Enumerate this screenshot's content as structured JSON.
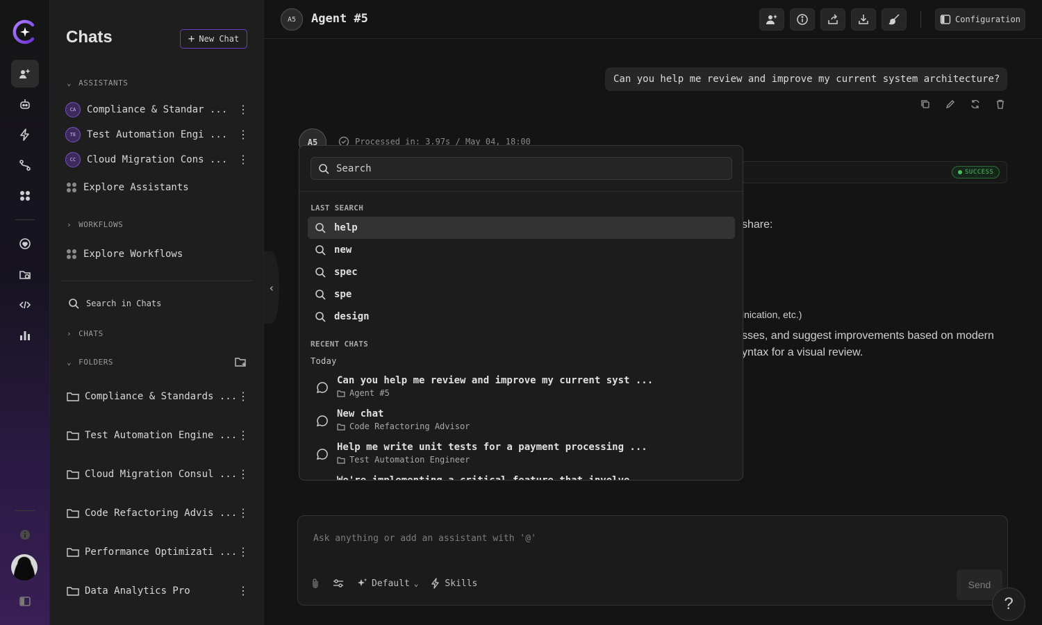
{
  "sidebar": {
    "title": "Chats",
    "new_chat": "New Chat",
    "assistants_label": "ASSISTANTS",
    "assistants": [
      {
        "initials": "CA",
        "name": "Compliance & Standar ..."
      },
      {
        "initials": "TE",
        "name": "Test Automation Engi ..."
      },
      {
        "initials": "CC",
        "name": "Cloud Migration Cons ..."
      }
    ],
    "explore_assistants": "Explore Assistants",
    "workflows_label": "WORKFLOWS",
    "explore_workflows": "Explore Workflows",
    "search_chats": "Search in Chats",
    "chats_label": "CHATS",
    "folders_label": "FOLDERS",
    "folders": [
      "Compliance & Standards ...",
      "Test Automation Engine ...",
      "Cloud Migration Consul ...",
      "Code Refactoring Advis ...",
      "Performance Optimizati ...",
      "Data Analytics Pro"
    ]
  },
  "header": {
    "agent_initials": "A5",
    "agent_name": "Agent #5",
    "configuration": "Configuration"
  },
  "conversation": {
    "user_message": "Can you help me review and improve my current system architecture?",
    "resp_initials": "A5",
    "processed": "Processed in: 3.97s / May 04, 18:00",
    "status": "SUCCESS",
    "fragments": [
      "share:",
      "inication, etc.)",
      "sses, and suggest improvements based on modern",
      "yntax for a visual review."
    ]
  },
  "composer": {
    "placeholder": "Ask anything or add an assistant with '@'",
    "model": "Default",
    "skills": "Skills",
    "send": "Send"
  },
  "search_popup": {
    "placeholder": "Search",
    "last_search_label": "LAST SEARCH",
    "last_search": [
      "help",
      "new",
      "spec",
      "spe",
      "design"
    ],
    "recent_label": "RECENT CHATS",
    "today_label": "Today",
    "recent": [
      {
        "title": "Can you help me review and improve my current syst ...",
        "assistant": "Agent #5"
      },
      {
        "title": "New chat",
        "assistant": "Code Refactoring Advisor"
      },
      {
        "title": "Help me write unit tests for a payment processing ...",
        "assistant": "Test Automation Engineer"
      },
      {
        "title": "We're implementing a critical feature that involve",
        "assistant": ""
      }
    ]
  },
  "help": "?"
}
